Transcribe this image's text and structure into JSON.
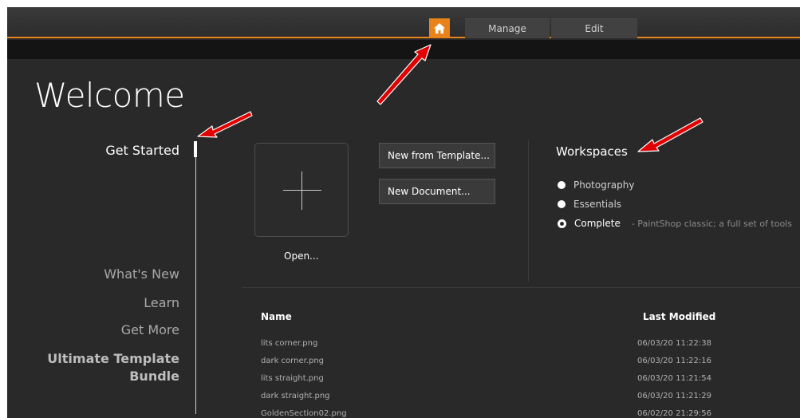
{
  "header": {
    "tabs": [
      {
        "label": ""
      },
      {
        "label": "Manage"
      },
      {
        "label": "Edit"
      }
    ]
  },
  "page": {
    "title": "Welcome"
  },
  "nav": {
    "items": [
      {
        "label": "Get Started"
      },
      {
        "label": "What's New"
      },
      {
        "label": "Learn"
      },
      {
        "label": "Get More"
      },
      {
        "label": "Ultimate Template Bundle"
      }
    ]
  },
  "actions": {
    "open_label": "Open...",
    "new_from_template": "New from Template...",
    "new_document": "New Document..."
  },
  "workspaces": {
    "title": "Workspaces",
    "options": [
      {
        "label": "Photography"
      },
      {
        "label": "Essentials"
      },
      {
        "label": "Complete",
        "description": "- PaintShop classic; a full set of tools"
      }
    ],
    "selected": "Complete"
  },
  "files": {
    "columns": {
      "name": "Name",
      "modified": "Last Modified"
    },
    "rows": [
      {
        "name": "lits corner.png",
        "modified": "06/03/20 11:22:38"
      },
      {
        "name": "dark corner.png",
        "modified": "06/03/20 11:22:16"
      },
      {
        "name": "lits straight.png",
        "modified": "06/03/20 11:21:54"
      },
      {
        "name": "dark straight.png",
        "modified": "06/03/20 11:21:29"
      },
      {
        "name": "GoldenSection02.png",
        "modified": "06/02/20 21:29:56"
      }
    ]
  },
  "colors": {
    "accent": "#e8831c",
    "background": "#292929",
    "annotation_arrow": "#e00000"
  },
  "icons": {
    "home": "home-icon",
    "plus": "plus-icon"
  }
}
